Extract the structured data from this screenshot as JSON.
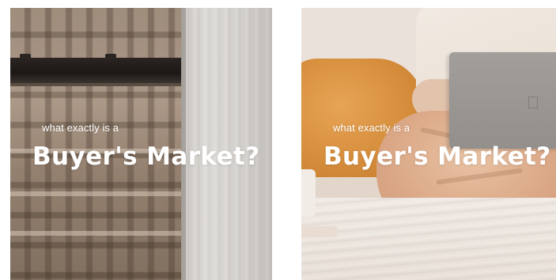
{
  "cards": [
    {
      "subtitle": "what exactly is a",
      "title": "Buyer's Market?"
    },
    {
      "subtitle": "what exactly is a",
      "title": "Buyer's Market?",
      "logo_icon": "apple-logo-icon"
    }
  ],
  "colors": {
    "overlay_text": "#ffffff",
    "pillow": "#d68e3c",
    "curtain": "#d6d3cf"
  }
}
